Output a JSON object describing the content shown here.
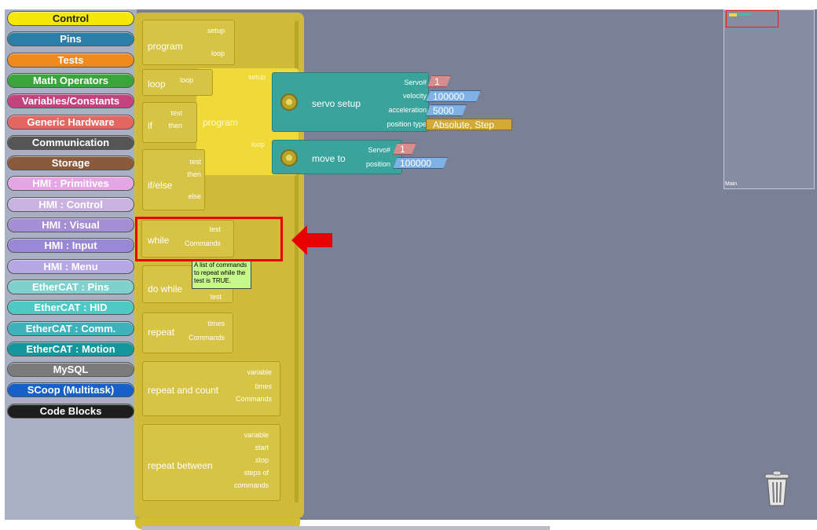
{
  "categories": [
    {
      "label": "Control",
      "color": "#f4e80a",
      "text": "#222222"
    },
    {
      "label": "Pins",
      "color": "#2b7fa8",
      "text": "#ffffff"
    },
    {
      "label": "Tests",
      "color": "#f08a1e",
      "text": "#ffffff"
    },
    {
      "label": "Math Operators",
      "color": "#3aa53a",
      "text": "#ffffff"
    },
    {
      "label": "Variables/Constants",
      "color": "#c4437e",
      "text": "#ffffff"
    },
    {
      "label": "Generic Hardware",
      "color": "#e46660",
      "text": "#ffffff"
    },
    {
      "label": "Communication",
      "color": "#555555",
      "text": "#ffffff"
    },
    {
      "label": "Storage",
      "color": "#8b5a3c",
      "text": "#ffffff"
    },
    {
      "label": "HMI : Primitives",
      "color": "#e4a6e4",
      "text": "#ffffff"
    },
    {
      "label": "HMI : Control",
      "color": "#c9b3e0",
      "text": "#ffffff"
    },
    {
      "label": "HMI : Visual",
      "color": "#a58fd4",
      "text": "#ffffff"
    },
    {
      "label": "HMI : Input",
      "color": "#9988d6",
      "text": "#ffffff"
    },
    {
      "label": "HMI : Menu",
      "color": "#b5a8e4",
      "text": "#ffffff"
    },
    {
      "label": "EtherCAT : Pins",
      "color": "#7fd1cd",
      "text": "#ffffff"
    },
    {
      "label": "EtherCAT : HID",
      "color": "#4ec9c4",
      "text": "#ffffff"
    },
    {
      "label": "EtherCAT : Comm.",
      "color": "#3fb1ba",
      "text": "#ffffff"
    },
    {
      "label": "EtherCAT : Motion",
      "color": "#14979c",
      "text": "#ffffff"
    },
    {
      "label": "MySQL",
      "color": "#7b7b7b",
      "text": "#ffffff"
    },
    {
      "label": "SCoop (Multitask)",
      "color": "#1560c9",
      "text": "#ffffff"
    },
    {
      "label": "Code Blocks",
      "color": "#1d1d1d",
      "text": "#ffffff"
    }
  ],
  "palette": {
    "program": {
      "title": "program",
      "setup": "setup",
      "loop": "loop"
    },
    "loop": {
      "title": "loop",
      "loop": "loop"
    },
    "if": {
      "title": "if",
      "test": "test",
      "then": "then"
    },
    "ifelse": {
      "title": "if/else",
      "test": "test",
      "then": "then",
      "else": "else"
    },
    "while": {
      "title": "while",
      "test": "test",
      "commands": "Commands"
    },
    "dowhile": {
      "title": "do while",
      "test": "test"
    },
    "repeat": {
      "title": "repeat",
      "times": "times",
      "commands": "Commands"
    },
    "repeatcount": {
      "title": "repeat and count",
      "variable": "variable",
      "times": "times",
      "commands": "Commands"
    },
    "repeatbetween": {
      "title": "repeat between",
      "variable": "variable",
      "start": "start",
      "stop": "stop",
      "steps": "steps of",
      "commands": "commands"
    }
  },
  "tooltip": "A list of commands to repeat while the test is TRUE.",
  "workspace": {
    "program": {
      "title": "program",
      "setup": "setup",
      "loop": "loop"
    },
    "servo_setup": {
      "title": "servo setup",
      "servo_label": "Servo#",
      "servo_value": "1",
      "velocity_label": "velocity",
      "velocity_value": "100000",
      "accel_label": "acceleration",
      "accel_value": "5000",
      "ptype_label": "position type",
      "ptype_value": "Absolute, Step"
    },
    "move_to": {
      "title": "move to",
      "servo_label": "Servo#",
      "servo_value": "1",
      "position_label": "position",
      "position_value": "100000"
    }
  },
  "minimap": {
    "label": "Main"
  }
}
